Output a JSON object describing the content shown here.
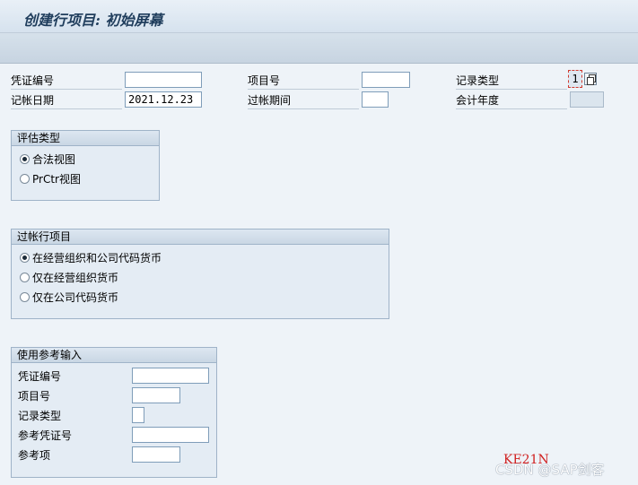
{
  "window": {
    "title": "创建行项目: 初始屏幕"
  },
  "header_fields": {
    "doc_no_label": "凭证编号",
    "doc_no_value": "",
    "item_no_label": "项目号",
    "item_no_value": "",
    "record_type_label": "记录类型",
    "record_type_value": "1",
    "posting_date_label": "记帐日期",
    "posting_date_value": "2021.12.23",
    "posting_period_label": "过帐期间",
    "posting_period_value": "",
    "fiscal_year_label": "会计年度",
    "fiscal_year_value": ""
  },
  "valuation_view": {
    "title": "评估类型",
    "options": [
      {
        "label": "合法视图",
        "selected": true
      },
      {
        "label": "PrCtr视图",
        "selected": false
      }
    ]
  },
  "posting_items": {
    "title": "过帐行项目",
    "options": [
      {
        "label": "在经营组织和公司代码货币",
        "selected": true
      },
      {
        "label": "仅在经营组织货币",
        "selected": false
      },
      {
        "label": "仅在公司代码货币",
        "selected": false
      }
    ]
  },
  "reference_input": {
    "title": "使用参考输入",
    "doc_no_label": "凭证编号",
    "doc_no_value": "",
    "item_no_label": "项目号",
    "item_no_value": "",
    "record_type_label": "记录类型",
    "record_type_value": "",
    "ref_doc_label": "参考凭证号",
    "ref_doc_value": "",
    "ref_item_label": "参考项",
    "ref_item_value": ""
  },
  "transaction_code": "KE21N",
  "watermark": "CSDN @SAP剑客"
}
